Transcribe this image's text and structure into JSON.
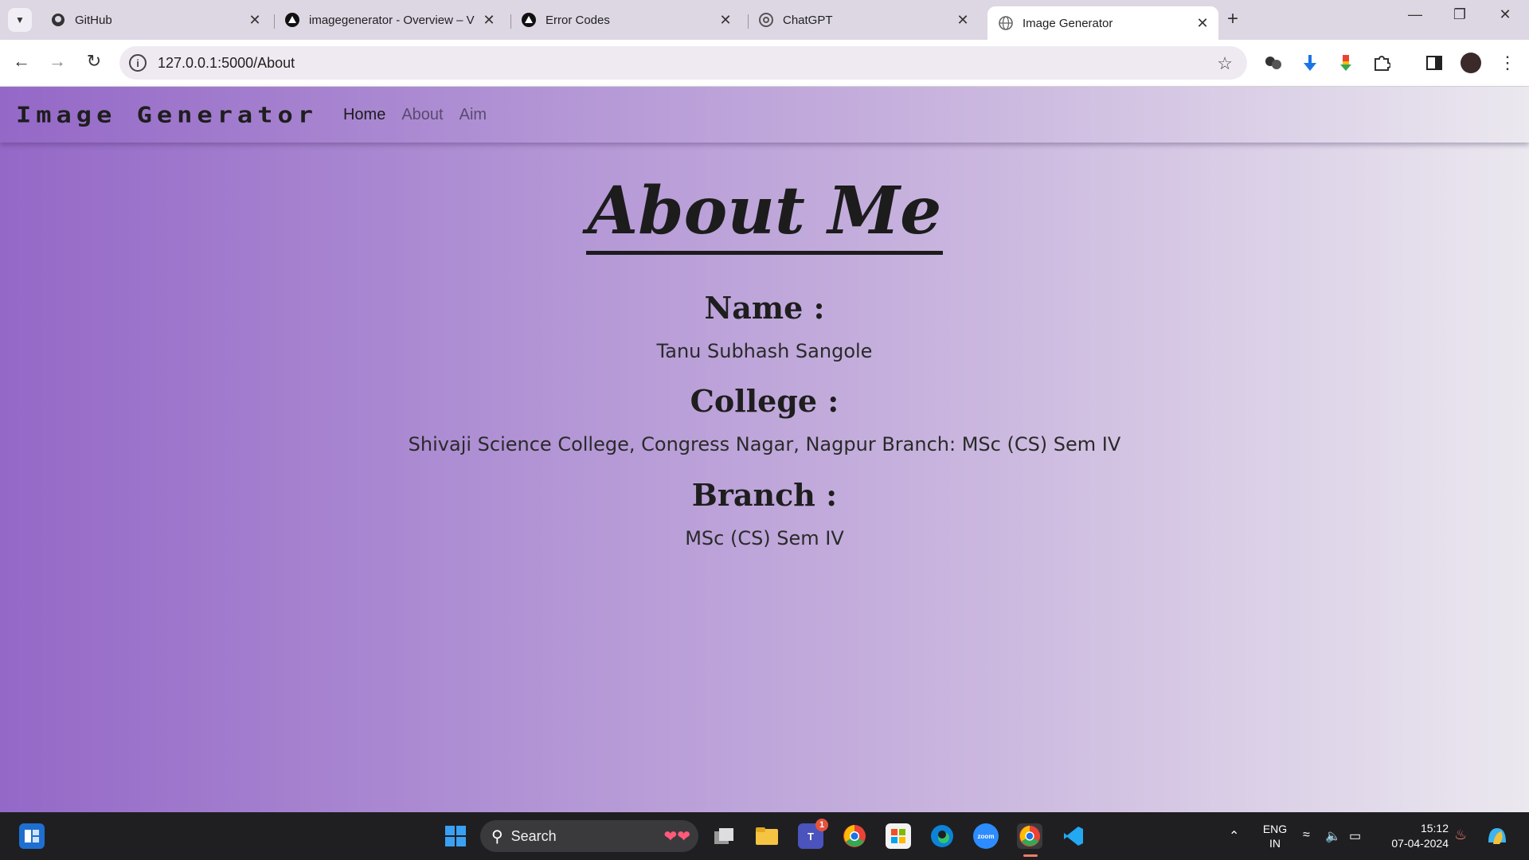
{
  "browser": {
    "tabs": [
      {
        "title": "GitHub",
        "icon": "github-icon",
        "active": false
      },
      {
        "title": "imagegenerator - Overview – V",
        "icon": "vercel-icon",
        "active": false
      },
      {
        "title": "Error Codes",
        "icon": "vercel-icon",
        "active": false
      },
      {
        "title": "ChatGPT",
        "icon": "chatgpt-icon",
        "active": false
      },
      {
        "title": "Image Generator",
        "icon": "globe-icon",
        "active": true
      }
    ],
    "url": "127.0.0.1:5000/About",
    "theme_color": "#ddd7e4"
  },
  "site": {
    "brand": "Image Generator",
    "nav": {
      "home": "Home",
      "about": "About",
      "aim": "Aim"
    },
    "gradient_start": "#9468c7",
    "gradient_end": "#ebe8ef"
  },
  "about": {
    "title": "About Me",
    "name_label": "Name :",
    "name_value": "Tanu Subhash Sangole",
    "college_label": "College :",
    "college_value": "Shivaji Science College, Congress Nagar, Nagpur Branch: MSc (CS) Sem IV",
    "branch_label": "Branch :",
    "branch_value": "MSc (CS) Sem IV"
  },
  "taskbar": {
    "search_label": "Search",
    "teams_badge": "1",
    "lang_line1": "ENG",
    "lang_line2": "IN",
    "time": "15:12",
    "date": "07-04-2024"
  }
}
